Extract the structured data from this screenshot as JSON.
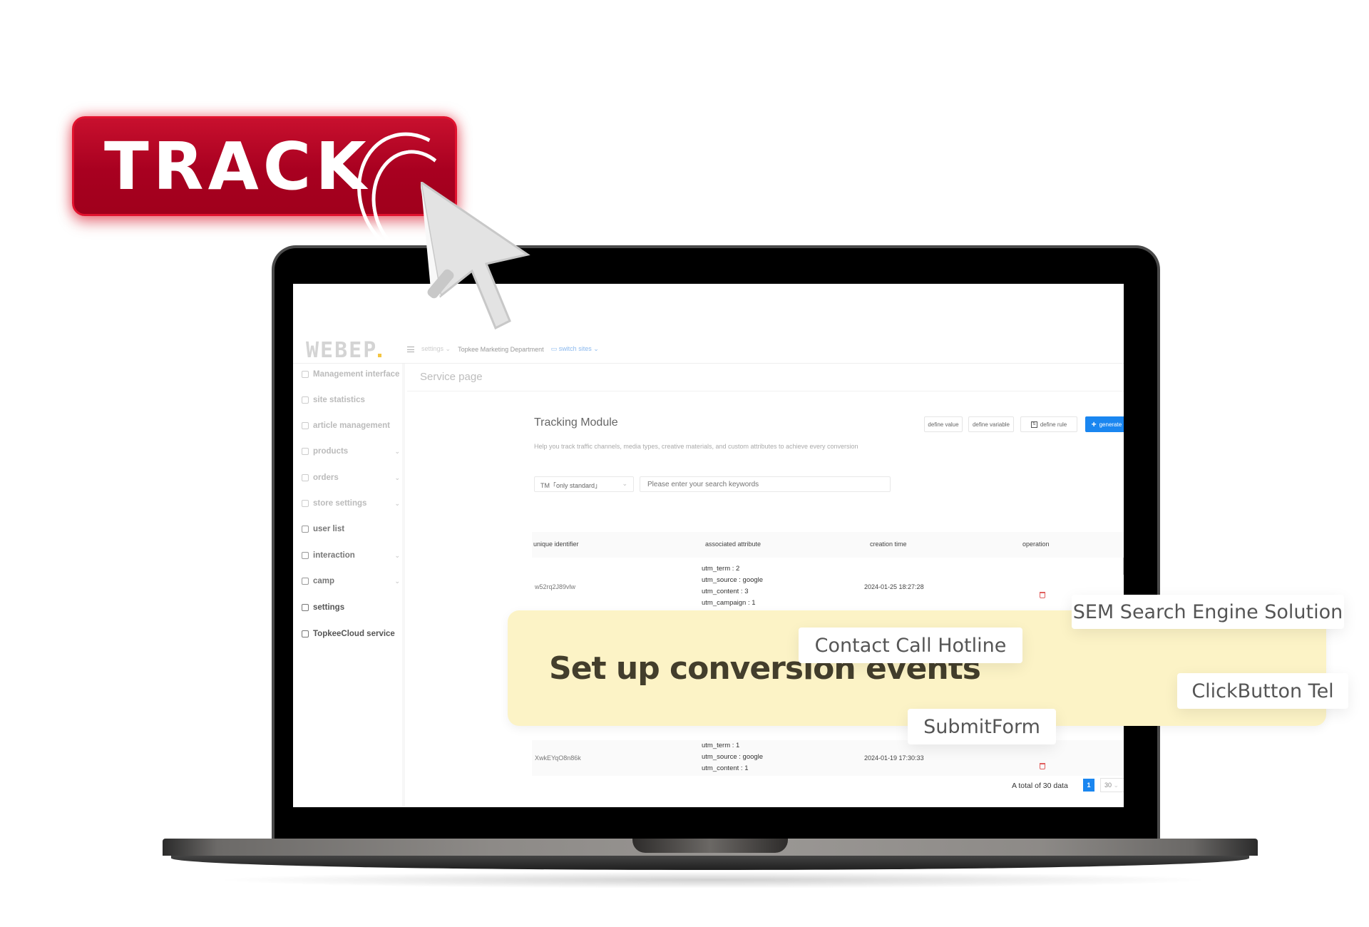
{
  "hero": {
    "track_label": "TRACK"
  },
  "app": {
    "logo": "WEBEP",
    "nav": {
      "settings": "settings",
      "department": "Topkee Marketing Department",
      "switch_sites": "switch sites"
    },
    "sidebar": {
      "items": [
        {
          "label": "Management interface",
          "icon": "home-icon",
          "has_chevron": false
        },
        {
          "label": "site statistics",
          "icon": "chart-icon",
          "has_chevron": false
        },
        {
          "label": "article management",
          "icon": "document-icon",
          "has_chevron": false
        },
        {
          "label": "products",
          "icon": "box-icon",
          "has_chevron": true
        },
        {
          "label": "orders",
          "icon": "bag-icon",
          "has_chevron": true
        },
        {
          "label": "store settings",
          "icon": "store-icon",
          "has_chevron": true
        },
        {
          "label": "user list",
          "icon": "users-icon",
          "has_chevron": false
        },
        {
          "label": "interaction",
          "icon": "refresh-icon",
          "has_chevron": true
        },
        {
          "label": "camp",
          "icon": "campaign-icon",
          "has_chevron": true
        },
        {
          "label": "settings",
          "icon": "gear-icon",
          "has_chevron": false
        },
        {
          "label": "TopkeeCloud service",
          "icon": "list-icon",
          "has_chevron": false
        }
      ],
      "chevron": "⌄"
    },
    "page_title": "Service page",
    "module": {
      "title": "Tracking Module",
      "description": "Help you track traffic channels, media types, creative materials, and custom attributes to achieve every conversion",
      "buttons": {
        "define_value": "define value",
        "define_variable": "define variable",
        "define_rule": "define rule",
        "generate_id": "generate ID"
      },
      "filter": {
        "select_value": "TM「only standard」",
        "search_placeholder": "Please enter your search keywords"
      },
      "table": {
        "headers": [
          "unique identifier",
          "associated attribute",
          "creation time",
          "operation"
        ],
        "rows": [
          {
            "id": "w52rq2J89vlw",
            "attributes": [
              "utm_term : 2",
              "utm_source : google",
              "utm_content : 3",
              "utm_campaign : 1"
            ],
            "created": "2024-01-25 18:27:28"
          },
          {
            "id": "XwkEYqO8n86k",
            "attributes": [
              "utm_term : 1",
              "utm_source : google",
              "utm_content : 1"
            ],
            "created": "2024-01-19 17:30:33"
          }
        ]
      },
      "pagination": {
        "total": "A total of 30 data",
        "current_page": "1",
        "page_size": "30"
      }
    }
  },
  "overlay": {
    "banner_title": "Set up conversion events",
    "tags": {
      "sem": "SEM Search Engine Solution",
      "hotline": "Contact Call Hotline",
      "click_tel": "ClickButton Tel",
      "submit_form": "SubmitForm"
    },
    "colors": {
      "track_red": "#a80020",
      "banner_yellow": "#fcf3c6",
      "primary_blue": "#1a86f0",
      "delete_red": "#e0605f"
    }
  }
}
